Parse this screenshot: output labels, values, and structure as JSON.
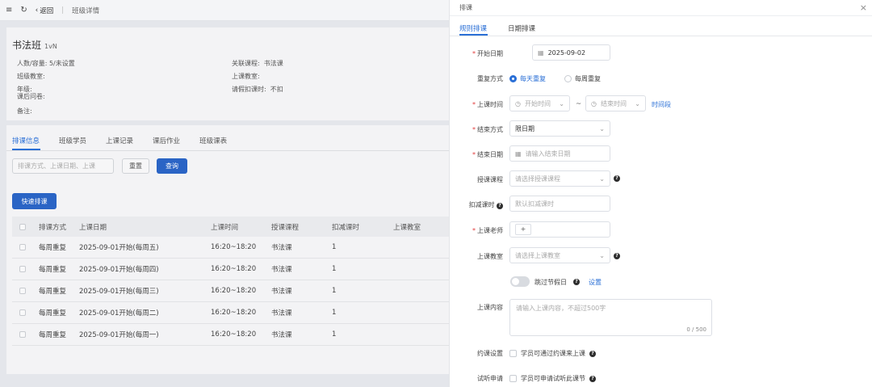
{
  "topbar": {
    "menu_icon": "menu-icon",
    "refresh_icon": "refresh-icon",
    "back_label": "返回",
    "crumb": "班级详情"
  },
  "class_info": {
    "name": "书法班",
    "code": "1vN",
    "fields": [
      {
        "label": "人数/容量:",
        "value": "5/未设置"
      },
      {
        "label": "关联课程:",
        "value": "书法课"
      },
      {
        "label": "班级教室:",
        "value": ""
      },
      {
        "label": "上课教室:",
        "value": ""
      },
      {
        "label": "年级:",
        "value": ""
      },
      {
        "label": "请假扣课时:",
        "value": "不扣"
      },
      {
        "label": "课后问卷:",
        "value": ""
      },
      {
        "label": "备注:",
        "value": ""
      }
    ]
  },
  "tabs": [
    "排课信息",
    "班级学员",
    "上课记录",
    "课后作业",
    "班级课表"
  ],
  "filter": {
    "placeholder": "排课方式、上课日期、上课",
    "reset_label": "重置",
    "query_label": "查询"
  },
  "quick_label": "快速排课",
  "table": {
    "headers": [
      "排课方式",
      "上课日期",
      "上课时间",
      "授课课程",
      "扣减课时",
      "上课教室"
    ],
    "rows": [
      [
        "每周重复",
        "2025-09-01开始(每周五)",
        "16:20~18:20",
        "书法课",
        "1",
        ""
      ],
      [
        "每周重复",
        "2025-09-01开始(每周四)",
        "16:20~18:20",
        "书法课",
        "1",
        ""
      ],
      [
        "每周重复",
        "2025-09-01开始(每周三)",
        "16:20~18:20",
        "书法课",
        "1",
        ""
      ],
      [
        "每周重复",
        "2025-09-01开始(每周二)",
        "16:20~18:20",
        "书法课",
        "1",
        ""
      ],
      [
        "每周重复",
        "2025-09-01开始(每周一)",
        "16:20~18:20",
        "书法课",
        "1",
        ""
      ]
    ]
  },
  "drawer": {
    "title": "排课",
    "tabs": [
      "规则排课",
      "日期排课"
    ],
    "start_date_label": "开始日期",
    "start_date_value": "2025-09-02",
    "repeat_label": "重复方式",
    "repeat_daily": "每天重复",
    "repeat_weekly": "每周重复",
    "time_label": "上课时间",
    "time_start_ph": "开始时间",
    "time_sep": "~",
    "time_end_ph": "结束时间",
    "time_slot_link": "时间段",
    "end_mode_label": "结束方式",
    "end_mode_value": "限日期",
    "end_date_label": "结束日期",
    "end_date_ph": "请输入结束日期",
    "course_label": "授课课程",
    "course_ph": "请选择授课课程",
    "deduct_label": "扣减课时",
    "deduct_ph": "默认扣减课时",
    "teacher_label": "上课老师",
    "teacher_add": "+",
    "room_label": "上课教室",
    "room_ph": "请选择上课教室",
    "skip_label": "跳过节假日",
    "skip_link": "设置",
    "content_label": "上课内容",
    "content_ph": "请输入上课内容，不超过500字",
    "content_count": "0 / 500",
    "booking_label": "约课设置",
    "booking_text": "学员可通过约课来上课",
    "trial_label": "试听申请",
    "trial_text": "学员可申请试听此课节"
  },
  "colors": {
    "accent": "#2a6fd6",
    "primary_button": "#2a64c5",
    "required": "#e23b3b"
  }
}
